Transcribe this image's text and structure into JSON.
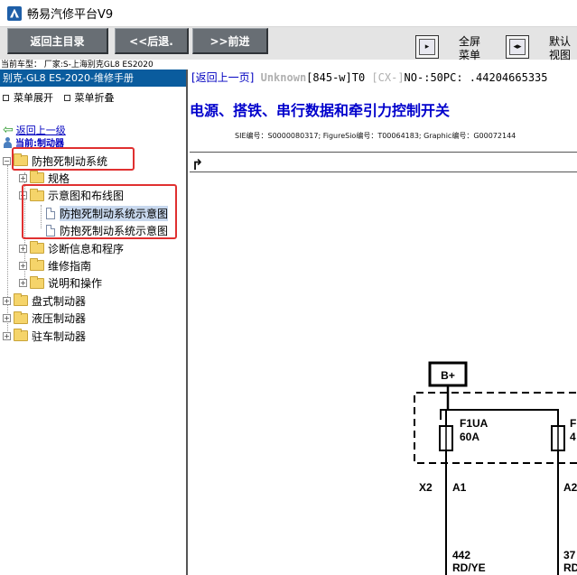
{
  "window": {
    "title": "畅易汽修平台V9"
  },
  "toolbar": {
    "home_label": "返回主目录",
    "back_label": "<<后退.",
    "forward_label": ">>前进",
    "fullscreen_label_1": "全屏",
    "fullscreen_label_2": "菜单",
    "default_label_1": "默认",
    "default_label_2": "视图"
  },
  "vehicle": {
    "line": "当前车型： 厂家:S-上海别克GL8 ES2020"
  },
  "left": {
    "manual_title": "别克-GL8 ES-2020-维修手册",
    "expand_label": "菜单展开",
    "collapse_label": "菜单折叠",
    "back_link": "返回上一级",
    "current": "当前:制动器",
    "tree": [
      {
        "label": "防抱死制动系统",
        "level": 0,
        "type": "folder",
        "expander": "−"
      },
      {
        "label": "规格",
        "level": 1,
        "type": "folder",
        "expander": "+"
      },
      {
        "label": "示意图和布线图",
        "level": 1,
        "type": "folder",
        "expander": "−"
      },
      {
        "label": "防抱死制动系统示意图",
        "level": 2,
        "type": "doc",
        "selected": true
      },
      {
        "label": "防抱死制动系统示意图",
        "level": 2,
        "type": "doc"
      },
      {
        "label": "诊断信息和程序",
        "level": 1,
        "type": "folder",
        "expander": "+"
      },
      {
        "label": "维修指南",
        "level": 1,
        "type": "folder",
        "expander": "+"
      },
      {
        "label": "说明和操作",
        "level": 1,
        "type": "folder",
        "expander": "+"
      },
      {
        "label": "盘式制动器",
        "level": 0,
        "type": "folder",
        "expander": "+"
      },
      {
        "label": "液压制动器",
        "level": 0,
        "type": "folder",
        "expander": "+"
      },
      {
        "label": "驻车制动器",
        "level": 0,
        "type": "folder",
        "expander": "+"
      }
    ]
  },
  "right": {
    "nav_back": "[返回上一页]",
    "nav_unknown": " Unknown",
    "nav_code": "[845-w]T0 ",
    "nav_cx": "[CX-]",
    "nav_no": "NO-:50PC: .44204665335",
    "title": "电源、搭铁、串行数据和牵引力控制开关",
    "sie_line": "SIE编号：S0000080317;  FigureSio编号：T00064183;  Graphic编号：G00072144",
    "redo_icon": "↱"
  },
  "diagram": {
    "bplus": "B+",
    "fuse1_name": "F1UA",
    "fuse1_amp": "60A",
    "fuse2_name": "F",
    "fuse2_amp": "4",
    "connector": "X2",
    "pin1": "A1",
    "pin2": "A2",
    "wire1_num": "442",
    "wire1_color": "RD/YE",
    "wire2_num": "37",
    "wire2_color": "RD"
  },
  "colors": {
    "manual_header": "#0a5c9e",
    "link": "#0000c0",
    "title": "#0000cc",
    "highlight_box": "#e03030",
    "toolbar_button": "#686e74"
  }
}
